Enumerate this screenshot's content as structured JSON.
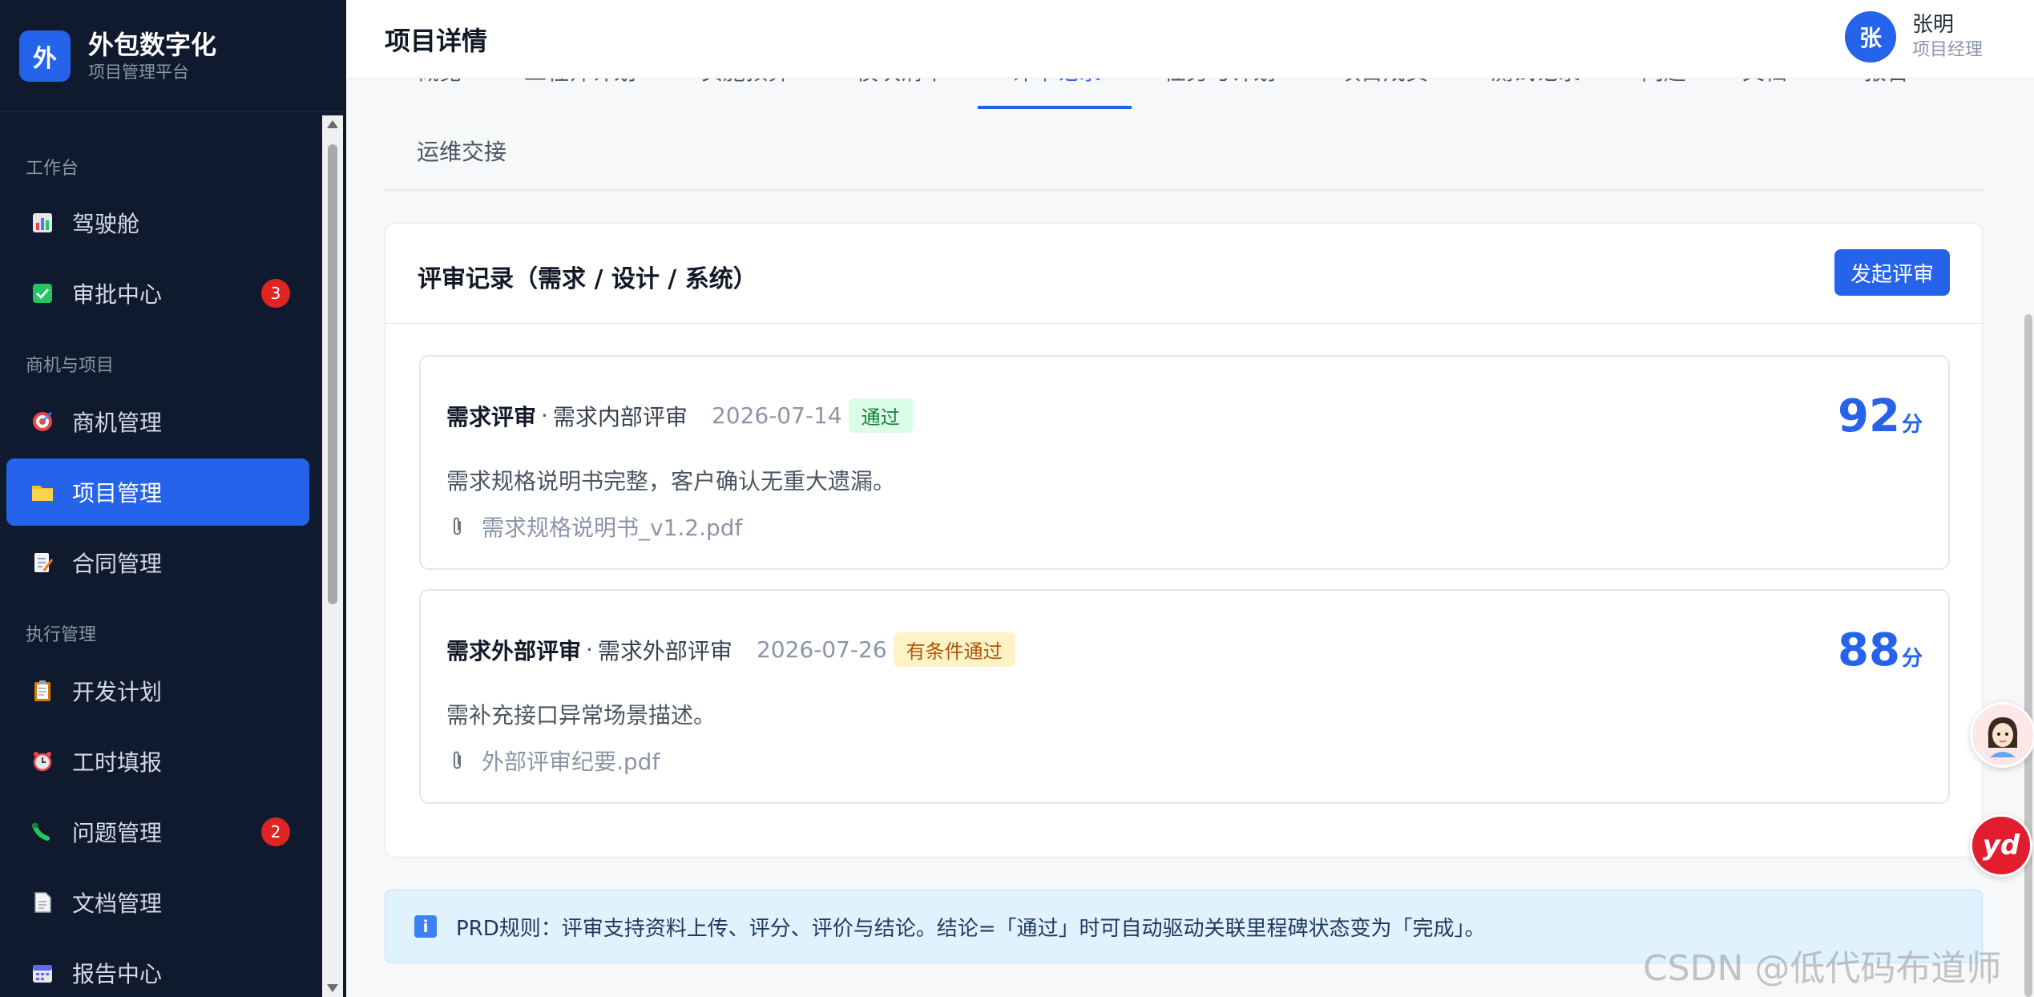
{
  "brand": {
    "logo": "外",
    "title": "外包数字化",
    "subtitle": "项目管理平台"
  },
  "nav": {
    "sections": {
      "workbench": "工作台",
      "biz": "商机与项目",
      "exec": "执行管理"
    },
    "items": [
      {
        "label": "驾驶舱",
        "icon": "chart-icon"
      },
      {
        "label": "审批中心",
        "icon": "checkbox-icon",
        "badge": "3"
      },
      {
        "label": "商机管理",
        "icon": "target-icon"
      },
      {
        "label": "项目管理",
        "icon": "folder-icon",
        "active": true
      },
      {
        "label": "合同管理",
        "icon": "memo-icon"
      },
      {
        "label": "开发计划",
        "icon": "clipboard-icon"
      },
      {
        "label": "工时填报",
        "icon": "alarm-clock-icon"
      },
      {
        "label": "问题管理",
        "icon": "bug-icon",
        "badge": "2"
      },
      {
        "label": "文档管理",
        "icon": "document-icon"
      },
      {
        "label": "报告中心",
        "icon": "calendar-icon"
      }
    ]
  },
  "header": {
    "title": "项目详情",
    "user": {
      "avatar": "张",
      "name": "张明",
      "role": "项目经理"
    }
  },
  "tabs": {
    "row1": [
      "概览",
      "工程师计划",
      "实施预算",
      "模块清单",
      "评审记录",
      "任务与计划",
      "项目成员",
      "测试记录",
      "问题",
      "文档",
      "报告"
    ],
    "row2": "运维交接"
  },
  "card": {
    "title": "评审记录（需求 / 设计 / 系统）",
    "action": "发起评审",
    "reviews": [
      {
        "type": "需求评审",
        "name": "需求内部评审",
        "date": "2026-07-14",
        "status": "通过",
        "score": "92",
        "unit": "分",
        "desc": "需求规格说明书完整，客户确认无重大遗漏。",
        "file": "需求规格说明书_v1.2.pdf"
      },
      {
        "type": "需求外部评审",
        "name": "需求外部评审",
        "date": "2026-07-26",
        "status": "有条件通过",
        "score": "88",
        "unit": "分",
        "desc": "需补充接口异常场景描述。",
        "file": "外部评审纪要.pdf"
      }
    ]
  },
  "alert": {
    "icon": "i",
    "text": "PRD规则：评审支持资料上传、评分、评价与结论。结论=「通过」时可自动驱动关联里程碑状态变为「完成」。"
  },
  "floating": {
    "yd": "yd"
  },
  "watermark": "CSDN @低代码布道师",
  "colors": {
    "primary": "#2563eb",
    "sidebar": "#0f1a2e",
    "badge": "#e02424",
    "pass": "#15803d",
    "conditional": "#b45309"
  }
}
